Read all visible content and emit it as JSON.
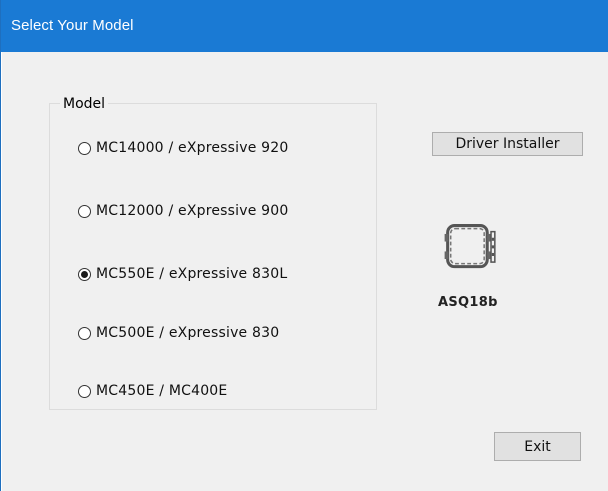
{
  "window": {
    "title": "Select Your Model"
  },
  "model_group": {
    "legend": "Model",
    "options": [
      {
        "label": "MC14000 / eXpressive 920",
        "checked": false
      },
      {
        "label": "MC12000 / eXpressive 900",
        "checked": false
      },
      {
        "label": "MC550E / eXpressive 830L",
        "checked": true
      },
      {
        "label": "MC500E / eXpressive 830",
        "checked": false
      },
      {
        "label": "MC450E / MC400E",
        "checked": false
      }
    ]
  },
  "buttons": {
    "driver_installer": "Driver Installer",
    "exit": "Exit"
  },
  "device": {
    "icon": "embroidery-hoop-icon",
    "label": "ASQ18b"
  },
  "colors": {
    "titlebar": "#1a7ad4",
    "background": "#f0f0f0",
    "button": "#e1e1e1"
  }
}
